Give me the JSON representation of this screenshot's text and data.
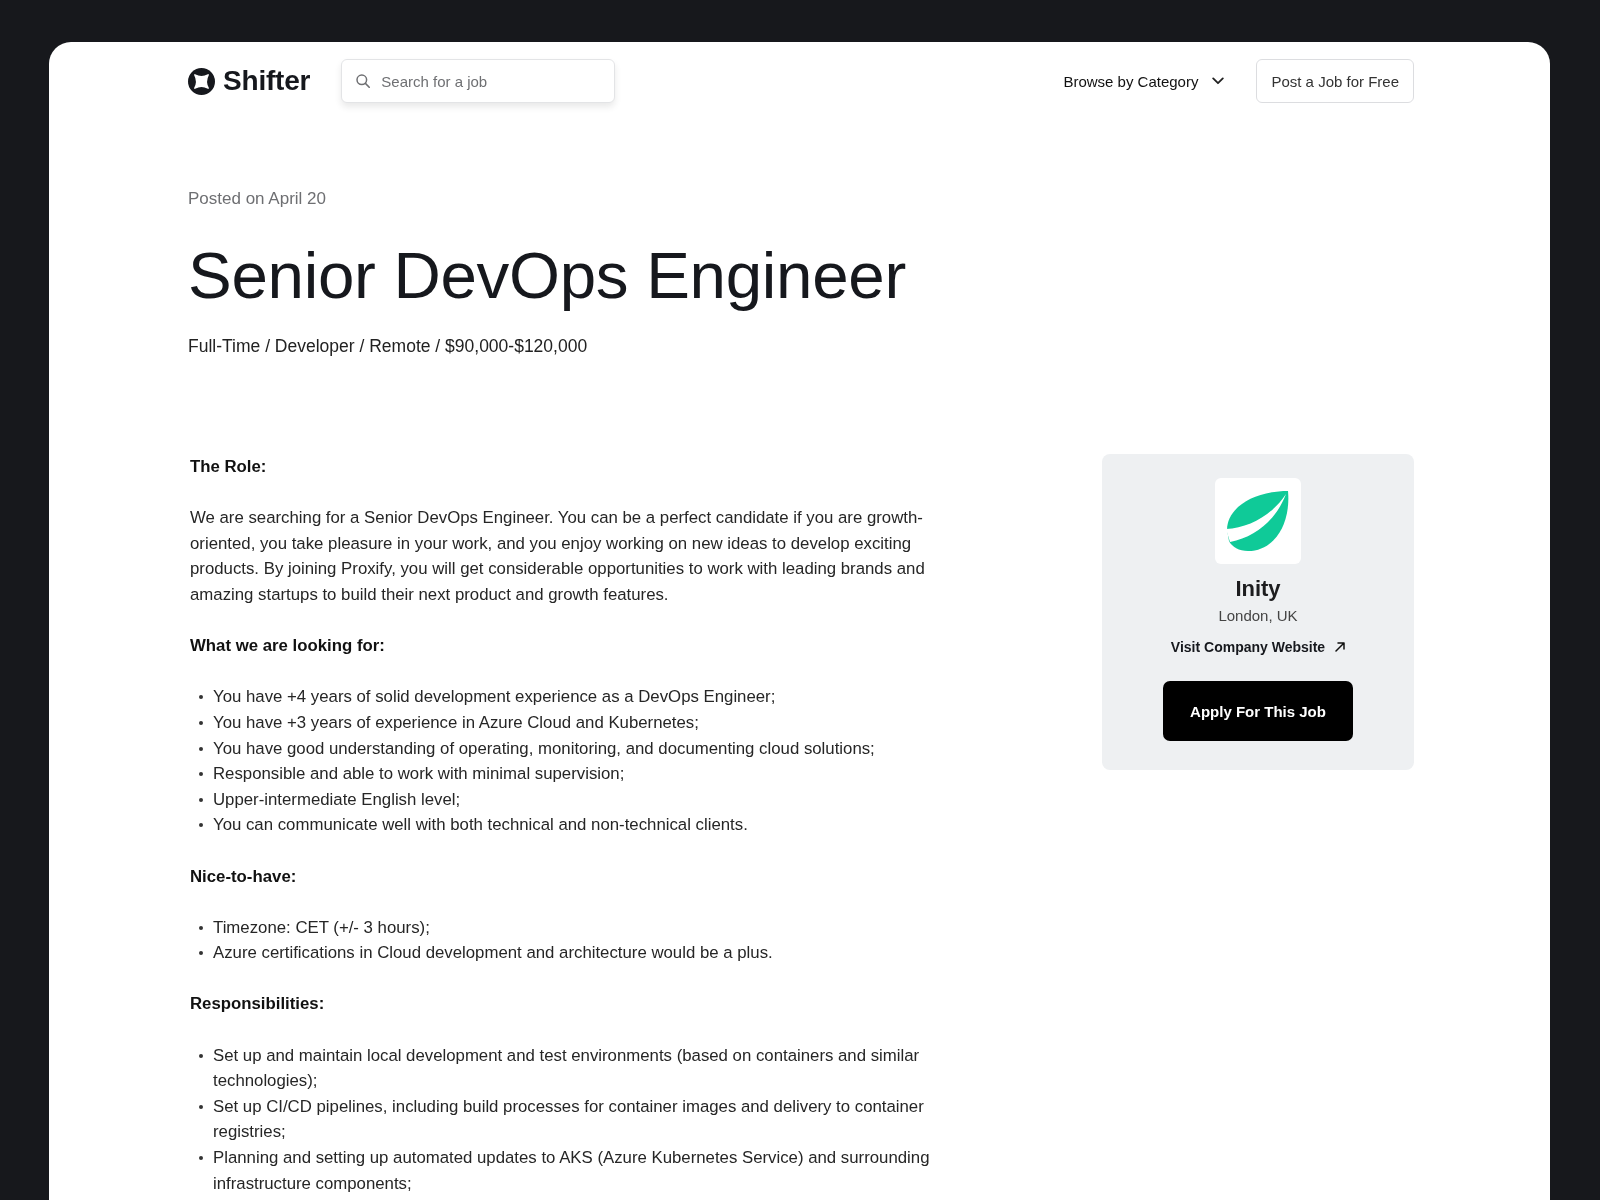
{
  "header": {
    "logo": "Shifter",
    "search": {
      "placeholder": "Search for a job"
    },
    "browse_menu": "Browse by Category",
    "post_button": "Post a Job for Free"
  },
  "job": {
    "posted": "Posted on April 20",
    "title": "Senior DevOps Engineer",
    "meta": "Full-Time / Developer / Remote / $90,000-$120,000"
  },
  "sections": [
    {
      "heading": "The Role:",
      "kind": "paragraph",
      "text": "We are searching for a Senior DevOps Engineer. You can be a perfect candidate if you are growth-oriented, you take pleasure in your work, and you enjoy working on new ideas to develop exciting products. By joining Proxify, you will get considerable opportunities to work with leading brands and amazing startups to build their next product and growth features."
    },
    {
      "heading": "What we are looking for:",
      "kind": "list",
      "items": [
        "You have +4 years of solid development experience as a DevOps Engineer;",
        "You have +3 years of experience in Azure Cloud and Kubernetes;",
        "You have good understanding of operating, monitoring, and documenting cloud solutions;",
        "Responsible and able to work with minimal supervision;",
        "Upper-intermediate English level;",
        "You can communicate well with both technical and non-technical clients."
      ]
    },
    {
      "heading": "Nice-to-have:",
      "kind": "list",
      "items": [
        "Timezone: CET (+/- 3 hours);",
        "Azure certifications in Cloud development and architecture would be a plus."
      ]
    },
    {
      "heading": "Responsibilities:",
      "kind": "list",
      "items": [
        "Set up and maintain local development and test environments (based on containers and similar technologies);",
        "Set up CI/CD pipelines, including build processes for container images and delivery to container registries;",
        "Planning and setting up automated updates to AKS (Azure Kubernetes Service) and surrounding infrastructure components;"
      ]
    }
  ],
  "company": {
    "name": "Inity",
    "location": "London, UK",
    "website_link": "Visit Company Website",
    "apply_button": "Apply For This Job"
  }
}
